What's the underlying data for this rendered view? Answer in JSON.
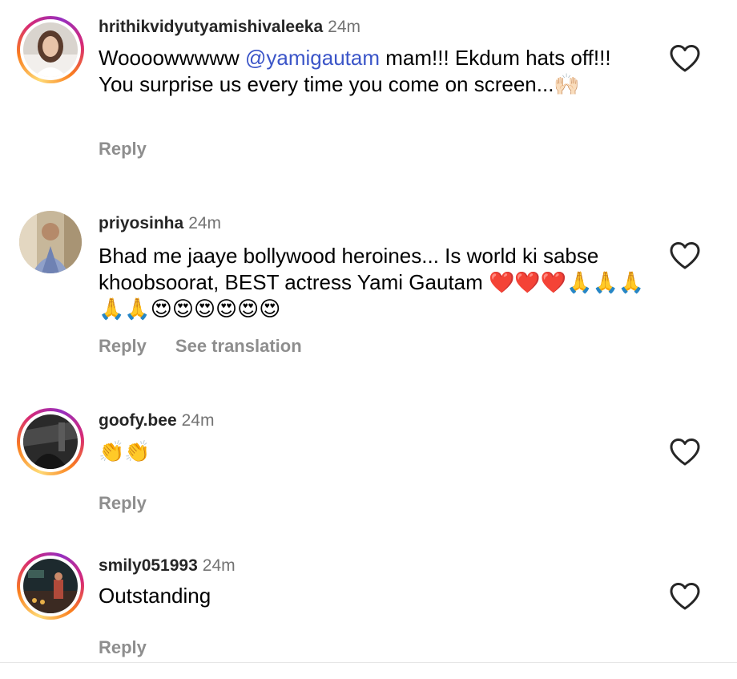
{
  "comments": [
    {
      "username": "hrithikvidyutyamishivaleeka",
      "time": "24m",
      "text_before": "Woooowwwww ",
      "mention": "@yamigautam",
      "text_after": " mam!!! Ekdum hats off!!! You surprise us every time you come on screen...🙌🏻",
      "reply_label": "Reply",
      "avatar_has_story_ring": true
    },
    {
      "username": "priyosinha",
      "time": "24m",
      "text": "Bhad me jaaye bollywood heroines... Is world ki sabse khoobsoorat, BEST actress Yami Gautam ❤️❤️❤️🙏🙏🙏🙏🙏😍😍😍😍😍😍",
      "reply_label": "Reply",
      "see_translation_label": "See translation",
      "avatar_has_story_ring": false
    },
    {
      "username": "goofy.bee",
      "time": "24m",
      "text": "👏👏",
      "reply_label": "Reply",
      "avatar_has_story_ring": true
    },
    {
      "username": "smily051993",
      "time": "24m",
      "text": "Outstanding",
      "reply_label": "Reply",
      "avatar_has_story_ring": true
    }
  ],
  "colors": {
    "mention": "#3b55c8",
    "secondary_text": "#8e8e8e",
    "timestamp": "#737373",
    "heart_outline": "#262626"
  },
  "icons": {
    "like": "heart-outline-icon"
  }
}
